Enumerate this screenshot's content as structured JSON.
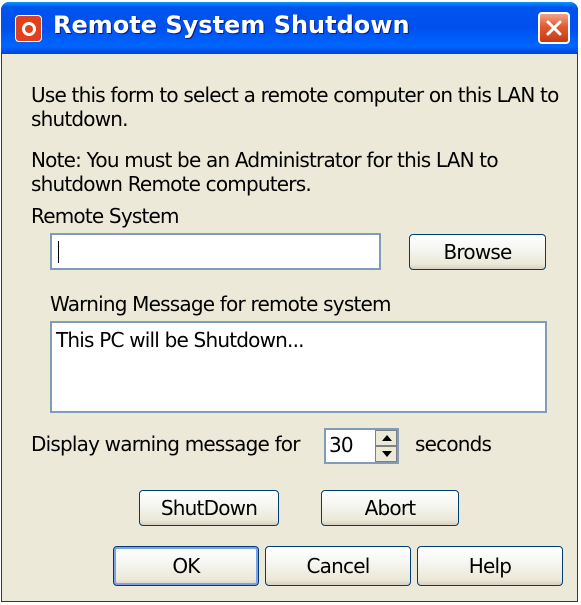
{
  "window": {
    "title": "Remote System Shutdown",
    "icons": {
      "app": "power-icon",
      "close": "close-icon"
    },
    "colors": {
      "titlebar": "#0053ee",
      "close_button": "#e35a31",
      "face": "#ece9d8"
    }
  },
  "form": {
    "intro": [
      "Use this form to select a remote computer on this LAN to",
      "shutdown."
    ],
    "note": [
      "Note: You must be an Administrator for this LAN to",
      "shutdown Remote computers."
    ],
    "remote_system_label": "Remote System",
    "remote_system_value": "",
    "browse_label": "Browse",
    "warning_label": "Warning Message for remote system",
    "warning_message": "This PC will be Shutdown...",
    "display_label": "Display warning message for",
    "seconds_value": "30",
    "seconds_unit": "seconds"
  },
  "actions": {
    "shutdown": "ShutDown",
    "abort": "Abort"
  },
  "footer": {
    "ok": "OK",
    "cancel": "Cancel",
    "help": "Help"
  }
}
